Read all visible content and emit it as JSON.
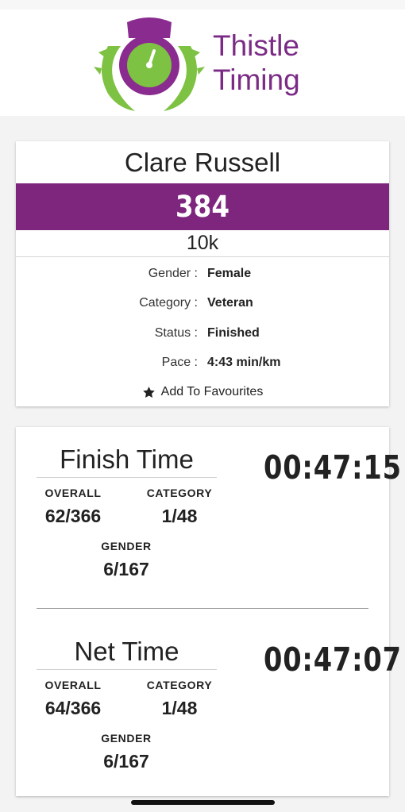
{
  "brand": {
    "line1": "Thistle",
    "line2": "Timing"
  },
  "runner": {
    "name": "Clare Russell",
    "bib": "384",
    "race": "10k",
    "details": [
      {
        "label": "Gender :",
        "value": "Female"
      },
      {
        "label": "Category :",
        "value": "Veteran"
      },
      {
        "label": "Status :",
        "value": "Finished"
      },
      {
        "label": "Pace :",
        "value": "4:43 min/km"
      }
    ],
    "favourites_label": "Add To Favourites"
  },
  "finish": {
    "title": "Finish Time",
    "time": "00:47:15",
    "overall_label": "OVERALL",
    "overall_value": "62/366",
    "category_label": "CATEGORY",
    "category_value": "1/48",
    "gender_label": "GENDER",
    "gender_value": "6/167"
  },
  "net": {
    "title": "Net Time",
    "time": "00:47:07",
    "overall_label": "OVERALL",
    "overall_value": "64/366",
    "category_label": "CATEGORY",
    "category_value": "1/48",
    "gender_label": "GENDER",
    "gender_value": "6/167"
  },
  "colors": {
    "brand_purple": "#7e267e",
    "logo_green": "#7dc242"
  }
}
